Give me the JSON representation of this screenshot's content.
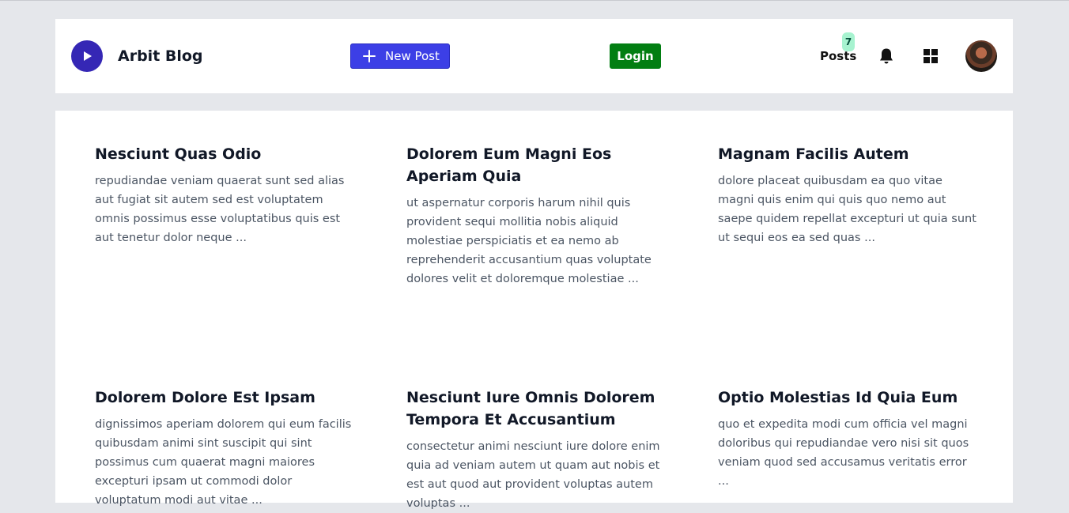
{
  "navbar": {
    "brand": "Arbit Blog",
    "new_post_label": "New Post",
    "login_label": "Login",
    "posts_label": "Posts",
    "posts_count": "7"
  },
  "colors": {
    "logo": "#3527b5",
    "new_post_button": "#3c3fe6",
    "login_button": "#027e12",
    "badge": "#a7f3d0"
  },
  "icons": [
    "play-icon",
    "plus-icon",
    "bell-icon",
    "grid-icon",
    "avatar"
  ],
  "posts": [
    {
      "title": "Nesciunt Quas Odio",
      "excerpt": "repudiandae veniam quaerat sunt sed alias aut fugiat sit autem sed est voluptatem omnis possimus esse voluptatibus quis est aut tenetur dolor neque ..."
    },
    {
      "title": "Dolorem Eum Magni Eos Aperiam Quia",
      "excerpt": "ut aspernatur corporis harum nihil quis provident sequi mollitia nobis aliquid molestiae perspiciatis et ea nemo ab reprehenderit accusantium quas voluptate dolores velit et doloremque molestiae ..."
    },
    {
      "title": "Magnam Facilis Autem",
      "excerpt": "dolore placeat quibusdam ea quo vitae magni quis enim qui quis quo nemo aut saepe quidem repellat excepturi ut quia sunt ut sequi eos ea sed quas ..."
    },
    {
      "title": "Dolorem Dolore Est Ipsam",
      "excerpt": "dignissimos aperiam dolorem qui eum facilis quibusdam animi sint suscipit qui sint possimus cum quaerat magni maiores excepturi ipsam ut commodi dolor voluptatum modi aut vitae ..."
    },
    {
      "title": "Nesciunt Iure Omnis Dolorem Tempora Et Accusantium",
      "excerpt": "consectetur animi nesciunt iure dolore enim quia ad veniam autem ut quam aut nobis et est aut quod aut provident voluptas autem voluptas ..."
    },
    {
      "title": "Optio Molestias Id Quia Eum",
      "excerpt": "quo et expedita modi cum officia vel magni doloribus qui repudiandae vero nisi sit quos veniam quod sed accusamus veritatis error ..."
    }
  ]
}
